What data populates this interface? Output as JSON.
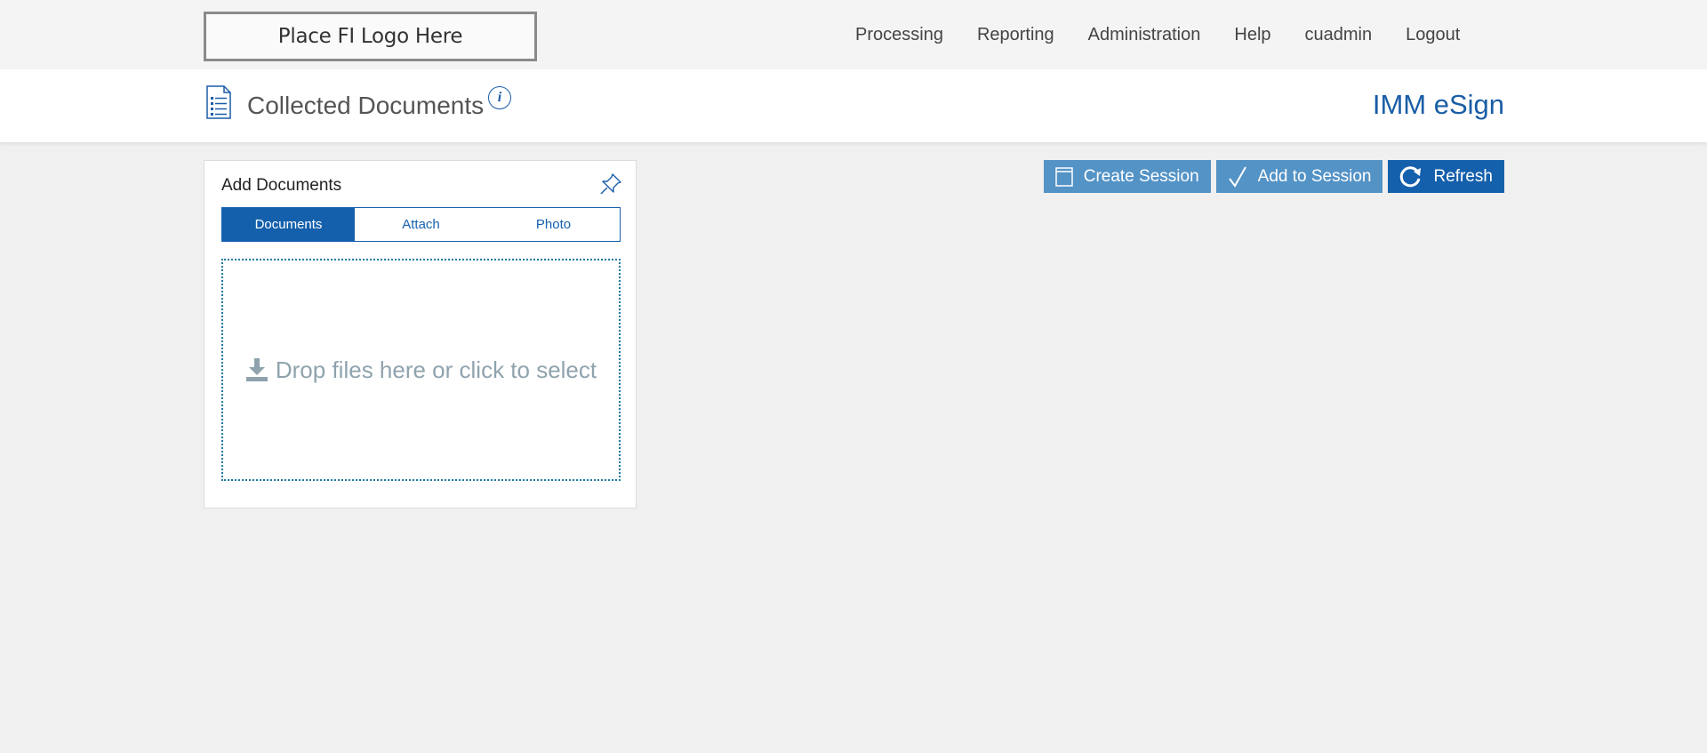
{
  "header": {
    "logo_text": "Place FI Logo Here",
    "nav": [
      {
        "label": "Processing"
      },
      {
        "label": "Reporting"
      },
      {
        "label": "Administration"
      },
      {
        "label": "Help"
      },
      {
        "label": "cuadmin"
      },
      {
        "label": "Logout"
      }
    ]
  },
  "page": {
    "title": "Collected Documents",
    "info_icon": "i",
    "brand": "IMM eSign"
  },
  "toolbar": {
    "create_session": "Create Session",
    "add_to_session": "Add to Session",
    "refresh": "Refresh"
  },
  "add_documents": {
    "title": "Add Documents",
    "tabs": [
      {
        "label": "Documents",
        "active": true
      },
      {
        "label": "Attach",
        "active": false
      },
      {
        "label": "Photo",
        "active": false
      }
    ],
    "dropzone_text": "Drop files here or click to select"
  },
  "colors": {
    "accent": "#1560ac",
    "button_light": "#5493c6",
    "dropzone_text": "#8fa3ad"
  }
}
